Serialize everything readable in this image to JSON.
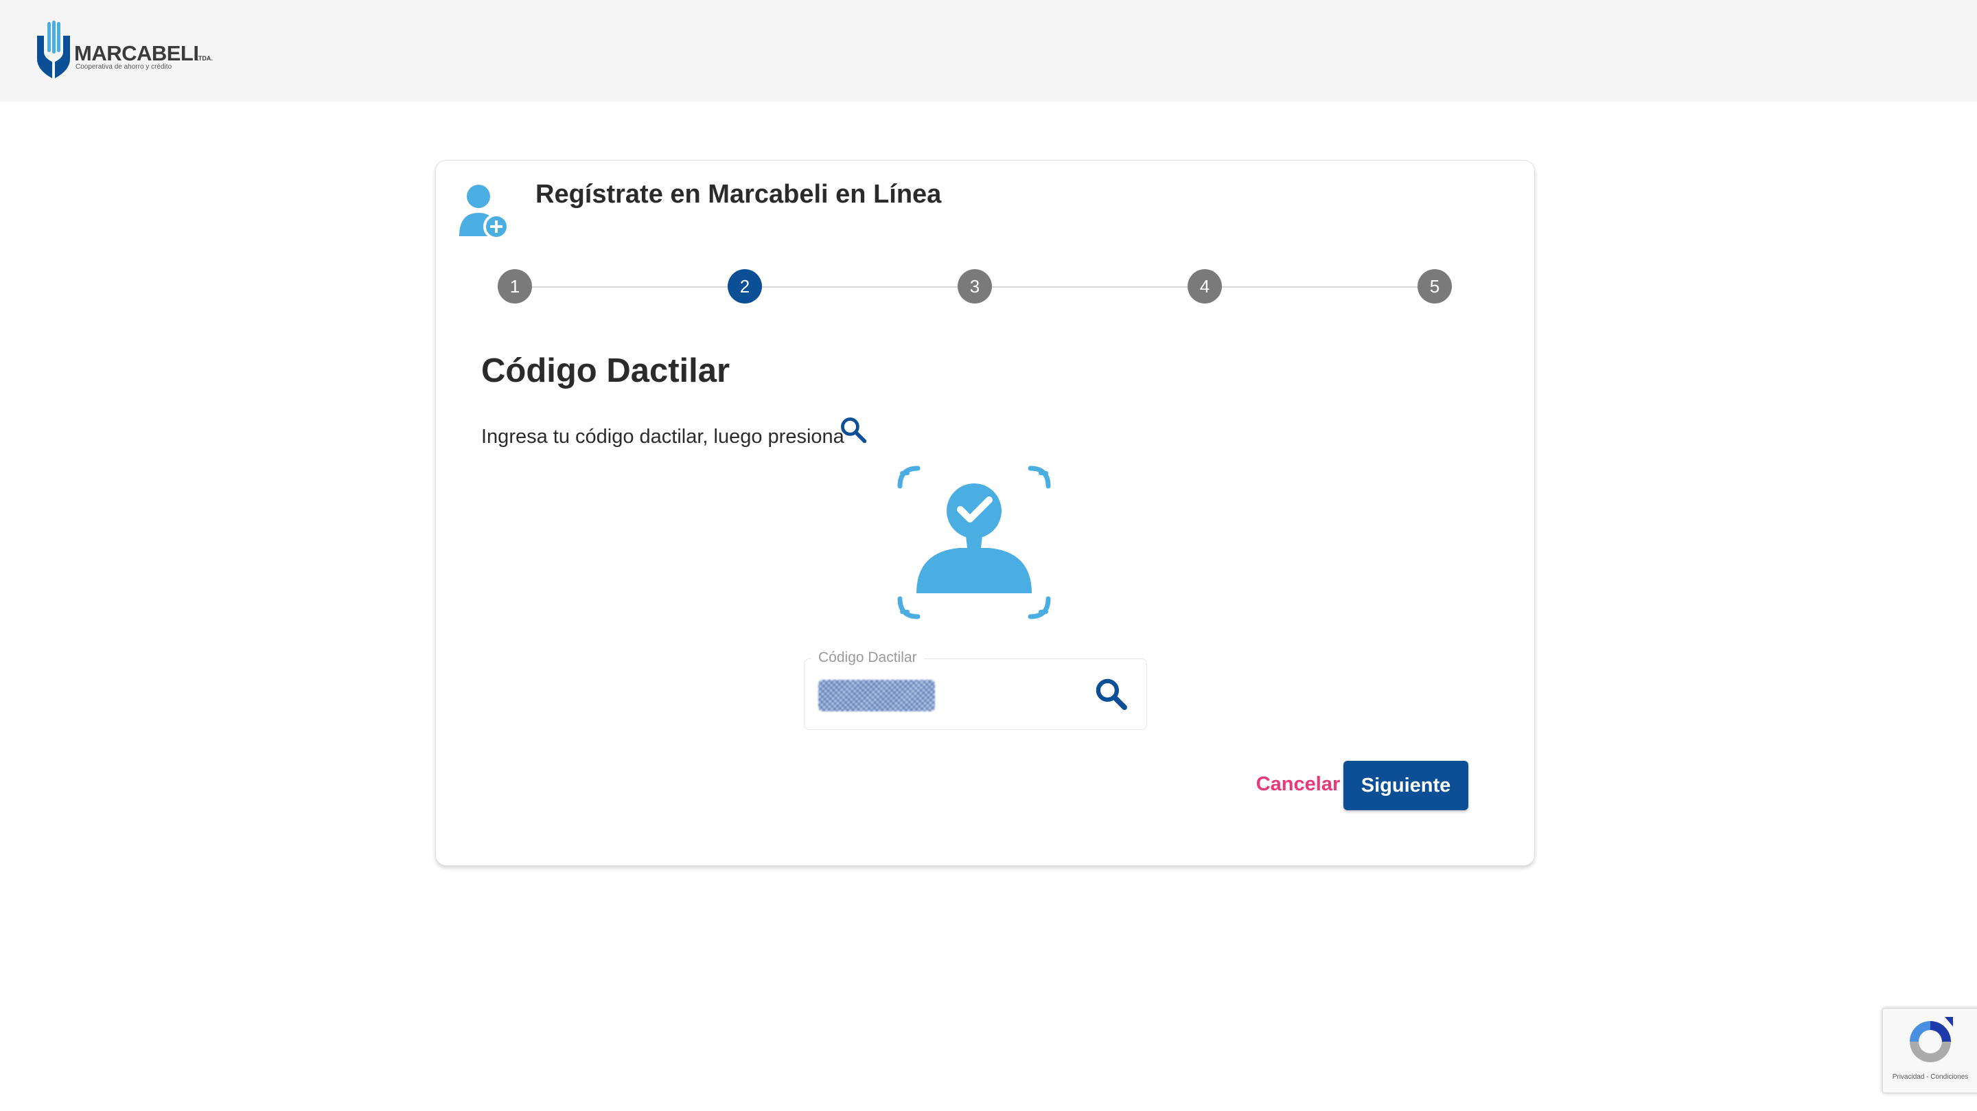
{
  "brand": {
    "name": "MARCABELI",
    "suffix": "LTDA.",
    "tagline": "Cooperativa de ahorro y crédito",
    "primary_color": "#0b4f96",
    "accent_color": "#4aaee3"
  },
  "card": {
    "title": "Regístrate en Marcabeli en Línea",
    "header_icon": "user-add-icon"
  },
  "stepper": {
    "steps": [
      "1",
      "2",
      "3",
      "4",
      "5"
    ],
    "active_step": 2
  },
  "section": {
    "title": "Código Dactilar",
    "instruction": "Ingresa tu código dactilar, luego presiona",
    "instruction_icon": "search-icon",
    "illustration_icon": "verified-user-icon"
  },
  "field": {
    "label": "Código Dactilar",
    "value_state": "redacted",
    "button_icon": "search-icon"
  },
  "actions": {
    "cancel_label": "Cancelar",
    "next_label": "Siguiente"
  },
  "recaptcha": {
    "links": "Privacidad - Condiciones",
    "icon": "recaptcha-icon"
  }
}
